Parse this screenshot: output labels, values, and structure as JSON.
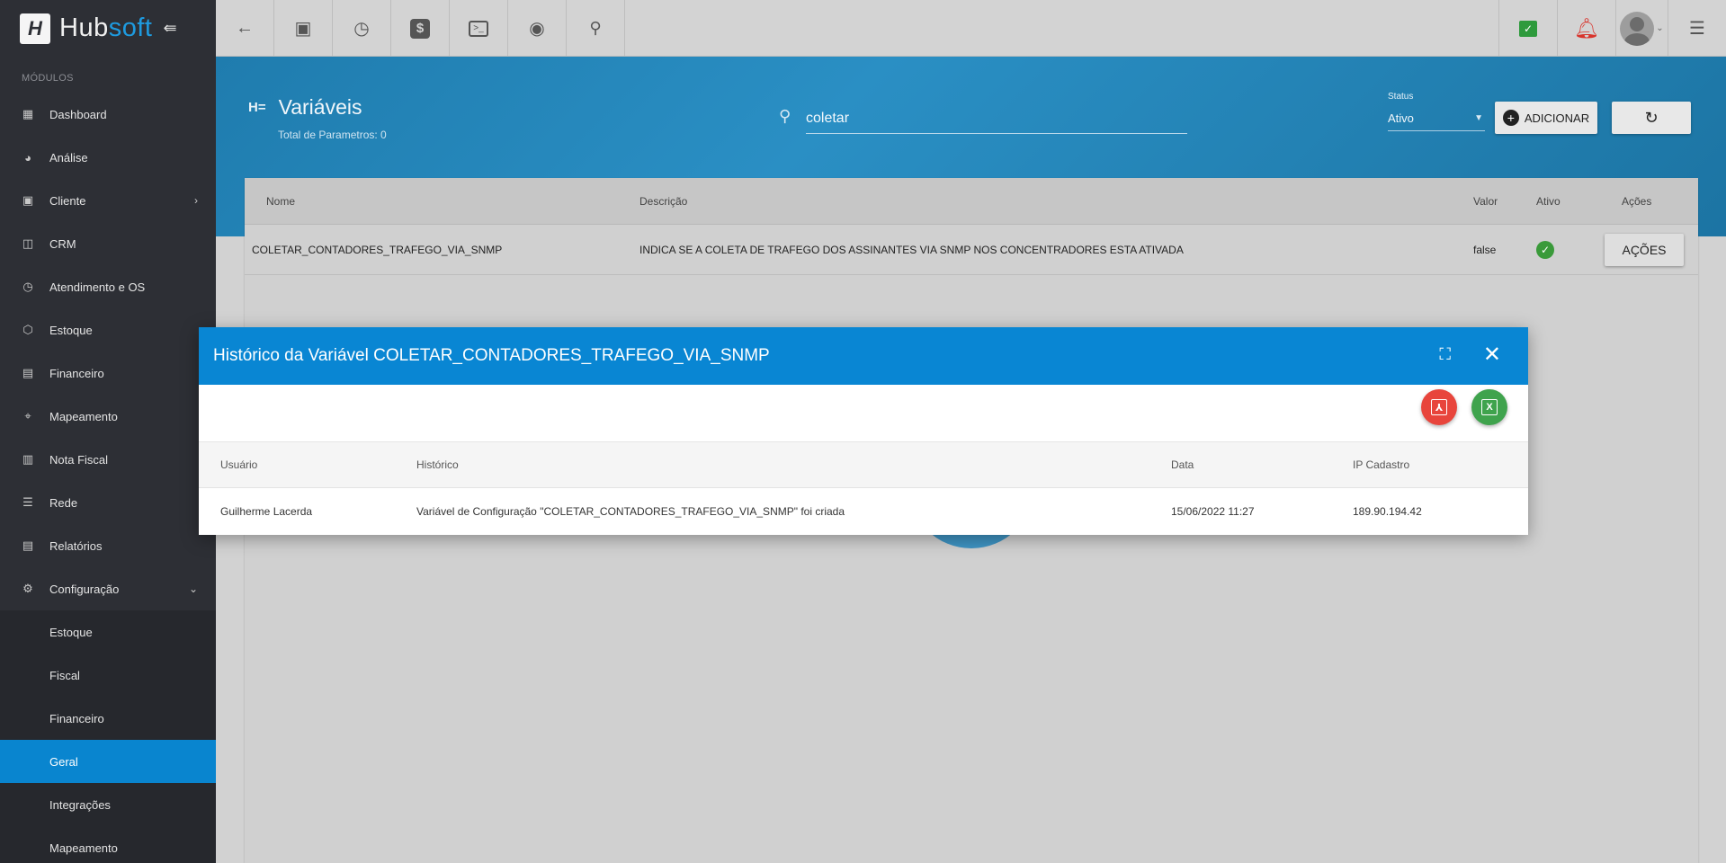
{
  "brand": {
    "name_part1": "Hub",
    "name_part2": "soft",
    "logo_letter": "H"
  },
  "sidebar": {
    "modules_label": "MÓDULOS",
    "items": [
      {
        "label": "Dashboard",
        "icon": "dashboard-icon"
      },
      {
        "label": "Análise",
        "icon": "chart-pie-icon"
      },
      {
        "label": "Cliente",
        "icon": "contact-card-icon",
        "has_chevron": true
      },
      {
        "label": "CRM",
        "icon": "board-icon"
      },
      {
        "label": "Atendimento e OS",
        "icon": "calendar-clock-icon"
      },
      {
        "label": "Estoque",
        "icon": "box-icon"
      },
      {
        "label": "Financeiro",
        "icon": "money-icon"
      },
      {
        "label": "Mapeamento",
        "icon": "map-pin-icon"
      },
      {
        "label": "Nota Fiscal",
        "icon": "invoice-icon"
      },
      {
        "label": "Rede",
        "icon": "server-icon"
      },
      {
        "label": "Relatórios",
        "icon": "report-icon"
      },
      {
        "label": "Configuração",
        "icon": "gear-icon",
        "expanded": true
      }
    ],
    "sub_items": [
      {
        "label": "Estoque"
      },
      {
        "label": "Fiscal"
      },
      {
        "label": "Financeiro"
      },
      {
        "label": "Geral",
        "active": true
      },
      {
        "label": "Integrações"
      },
      {
        "label": "Mapeamento"
      }
    ]
  },
  "topbar": {
    "buttons": [
      "back-arrow-icon",
      "contact-icon",
      "calendar-clock-icon",
      "dollar-icon",
      "terminal-icon",
      "eye-icon",
      "search-icon"
    ],
    "right_buttons": [
      "chat-check-icon",
      "bell-alert-icon"
    ]
  },
  "header": {
    "title": "Variáveis",
    "subtitle": "Total de Parametros: 0",
    "search_value": "coletar",
    "status_label": "Status",
    "status_value": "Ativo",
    "add_label": "ADICIONAR"
  },
  "table": {
    "columns": {
      "nome": "Nome",
      "descricao": "Descrição",
      "valor": "Valor",
      "ativo": "Ativo",
      "acoes": "Ações"
    },
    "rows": [
      {
        "nome": "COLETAR_CONTADORES_TRAFEGO_VIA_SNMP",
        "descricao": "INDICA SE A COLETA DE TRAFEGO DOS ASSINANTES VIA SNMP NOS CONCENTRADORES ESTA ATIVADA",
        "valor": "false",
        "acoes_label": "AÇÕES"
      }
    ]
  },
  "modal": {
    "title": "Histórico da Variável COLETAR_CONTADORES_TRAFEGO_VIA_SNMP",
    "columns": {
      "usuario": "Usuário",
      "historico": "Histórico",
      "data": "Data",
      "ip": "IP Cadastro"
    },
    "rows": [
      {
        "usuario": "Guilherme Lacerda",
        "historico": "Variável de Configuração \"COLETAR_CONTADORES_TRAFEGO_VIA_SNMP\" foi criada",
        "data": "15/06/2022 11:27",
        "ip": "189.90.194.42"
      }
    ]
  },
  "colors": {
    "accent": "#0986d3",
    "sidebar_bg": "#2d2f35",
    "active_nav": "#0985cf",
    "pdf": "#e8453c",
    "excel": "#3fa34d"
  }
}
